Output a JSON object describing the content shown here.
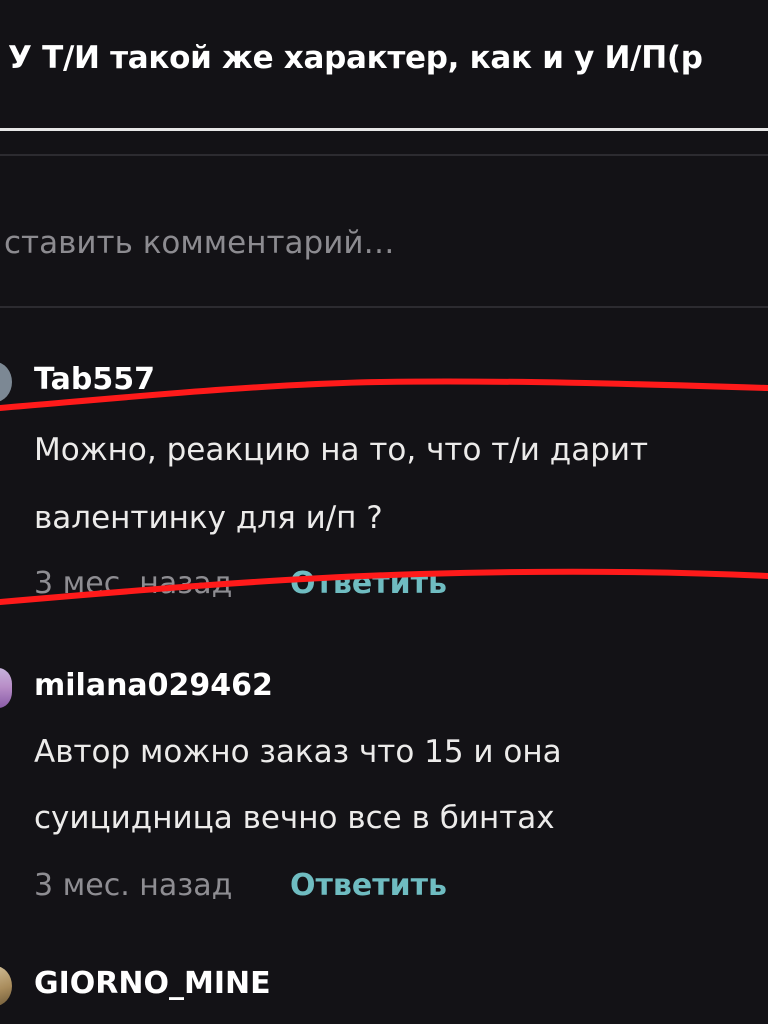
{
  "header": {
    "title": "У Т/И такой же характер, как и у И/П(р"
  },
  "comment_box": {
    "placeholder": "ставить комментарий…"
  },
  "comments": [
    {
      "username": "Tab557",
      "lines": [
        "Можно, реакцию на то, что т/и дарит",
        "валентинку для и/п ?"
      ],
      "timestamp": "3 мес. назад",
      "reply_label": "Ответить"
    },
    {
      "username": "milana029462",
      "lines": [
        "Автор можно заказ что 15 и она",
        "суицидница вечно все в бинтах"
      ],
      "timestamp": "3 мес. назад",
      "reply_label": "Ответить"
    },
    {
      "username": "GIORNO_MINE"
    }
  ],
  "colors": {
    "background": "#131216",
    "reply_link": "#6fbcc1",
    "timestamp": "#8e8d92",
    "markup_stroke": "#ff1a1a"
  }
}
